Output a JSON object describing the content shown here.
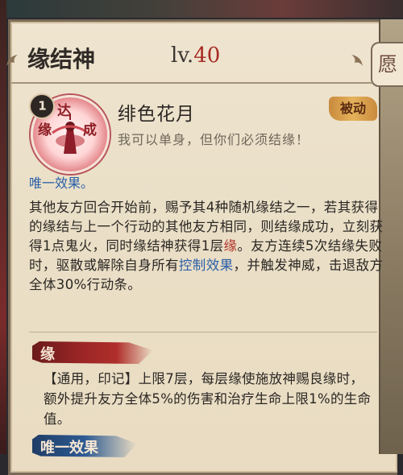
{
  "header": {
    "title": "缘结神",
    "level_prefix": "lv.",
    "level_value": "40",
    "side_tab_glyph": "愿"
  },
  "skill": {
    "slot_number": "1",
    "avatar_chars": [
      "缘",
      "达",
      "成"
    ],
    "name": "绯色花月",
    "type_tag": "被动",
    "quote": "我可以单身，但你们必须结缘！",
    "unique_label": "唯一效果。",
    "description_parts": {
      "p1": "其他友方回合开始前，赐予其4种随机缘结之一，若其获得的缘结与上一个行动的其他友方相同，则结缘成功，立刻获得1点鬼火，同时缘结神获得1层",
      "kw1": "缘",
      "p2": "。友方连续5次结缘失败时，驱散或解除自身所有",
      "kw2": "控制效果",
      "p3": "，并触发神威，击退敌方全体30%行动条。"
    }
  },
  "buff_section": {
    "ribbon_label": "缘",
    "description": "【通用，印记】上限7层，每层缘使施放神赐良缘时，额外提升友方全体5%的伤害和治疗生命上限1%的生命值。"
  },
  "next_section": {
    "ribbon_label": "唯一效果"
  },
  "colors": {
    "accent_red": "#b0312a",
    "keyword_blue": "#2b60a8",
    "panel_bg": "#efe4cf"
  },
  "icons": {
    "corner_left": "ornament-icon",
    "corner_right": "ornament-icon"
  }
}
